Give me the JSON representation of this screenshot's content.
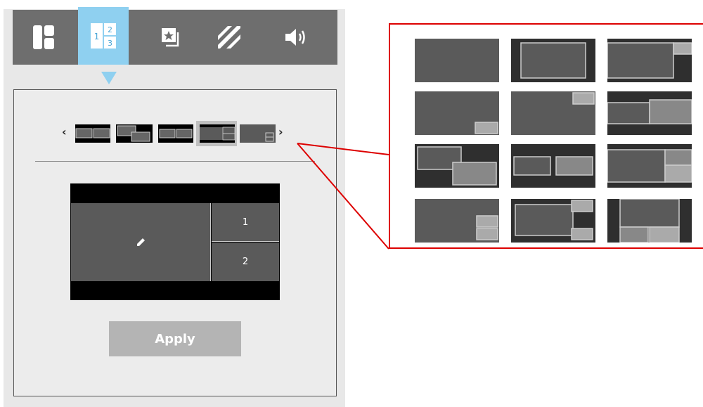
{
  "toolbar": {
    "buttons": [
      {
        "icon": "layout-grid-icon",
        "active": false
      },
      {
        "icon": "numbered-layout-icon",
        "active": true
      },
      {
        "icon": "star-window-icon",
        "active": false
      },
      {
        "icon": "diagonal-stripes-icon",
        "active": false
      },
      {
        "icon": "speaker-icon",
        "active": false
      }
    ],
    "numbered_icon_digits": [
      "1",
      "2",
      "3"
    ]
  },
  "carousel": {
    "prev_label": "‹",
    "next_label": "›",
    "selected_index": 3
  },
  "preview": {
    "slot_1": "1",
    "slot_2": "2",
    "edit_icon": "pencil-icon"
  },
  "apply_label": "Apply",
  "colors": {
    "active_tab": "#8fd0f0",
    "toolbar": "#6e6e6e",
    "callout_border": "#dd0000",
    "apply_button": "#b4b4b4"
  }
}
